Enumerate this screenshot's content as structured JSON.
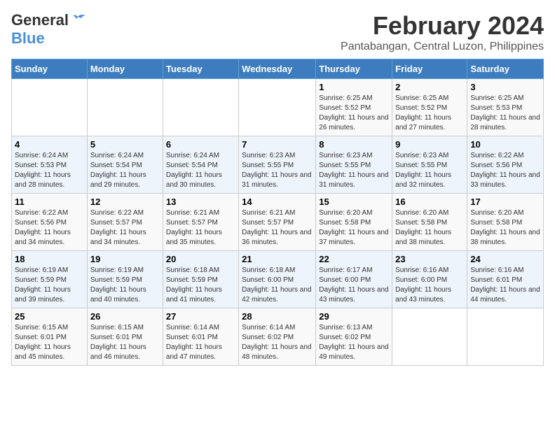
{
  "logo": {
    "general": "General",
    "blue": "Blue"
  },
  "title": "February 2024",
  "subtitle": "Pantabangan, Central Luzon, Philippines",
  "days": [
    "Sunday",
    "Monday",
    "Tuesday",
    "Wednesday",
    "Thursday",
    "Friday",
    "Saturday"
  ],
  "weeks": [
    [
      {
        "day": "",
        "info": ""
      },
      {
        "day": "",
        "info": ""
      },
      {
        "day": "",
        "info": ""
      },
      {
        "day": "",
        "info": ""
      },
      {
        "day": "1",
        "info": "Sunrise: 6:25 AM\nSunset: 5:52 PM\nDaylight: 11 hours and 26 minutes."
      },
      {
        "day": "2",
        "info": "Sunrise: 6:25 AM\nSunset: 5:52 PM\nDaylight: 11 hours and 27 minutes."
      },
      {
        "day": "3",
        "info": "Sunrise: 6:25 AM\nSunset: 5:53 PM\nDaylight: 11 hours and 28 minutes."
      }
    ],
    [
      {
        "day": "4",
        "info": "Sunrise: 6:24 AM\nSunset: 5:53 PM\nDaylight: 11 hours and 28 minutes."
      },
      {
        "day": "5",
        "info": "Sunrise: 6:24 AM\nSunset: 5:54 PM\nDaylight: 11 hours and 29 minutes."
      },
      {
        "day": "6",
        "info": "Sunrise: 6:24 AM\nSunset: 5:54 PM\nDaylight: 11 hours and 30 minutes."
      },
      {
        "day": "7",
        "info": "Sunrise: 6:23 AM\nSunset: 5:55 PM\nDaylight: 11 hours and 31 minutes."
      },
      {
        "day": "8",
        "info": "Sunrise: 6:23 AM\nSunset: 5:55 PM\nDaylight: 11 hours and 31 minutes."
      },
      {
        "day": "9",
        "info": "Sunrise: 6:23 AM\nSunset: 5:55 PM\nDaylight: 11 hours and 32 minutes."
      },
      {
        "day": "10",
        "info": "Sunrise: 6:22 AM\nSunset: 5:56 PM\nDaylight: 11 hours and 33 minutes."
      }
    ],
    [
      {
        "day": "11",
        "info": "Sunrise: 6:22 AM\nSunset: 5:56 PM\nDaylight: 11 hours and 34 minutes."
      },
      {
        "day": "12",
        "info": "Sunrise: 6:22 AM\nSunset: 5:57 PM\nDaylight: 11 hours and 34 minutes."
      },
      {
        "day": "13",
        "info": "Sunrise: 6:21 AM\nSunset: 5:57 PM\nDaylight: 11 hours and 35 minutes."
      },
      {
        "day": "14",
        "info": "Sunrise: 6:21 AM\nSunset: 5:57 PM\nDaylight: 11 hours and 36 minutes."
      },
      {
        "day": "15",
        "info": "Sunrise: 6:20 AM\nSunset: 5:58 PM\nDaylight: 11 hours and 37 minutes."
      },
      {
        "day": "16",
        "info": "Sunrise: 6:20 AM\nSunset: 5:58 PM\nDaylight: 11 hours and 38 minutes."
      },
      {
        "day": "17",
        "info": "Sunrise: 6:20 AM\nSunset: 5:58 PM\nDaylight: 11 hours and 38 minutes."
      }
    ],
    [
      {
        "day": "18",
        "info": "Sunrise: 6:19 AM\nSunset: 5:59 PM\nDaylight: 11 hours and 39 minutes."
      },
      {
        "day": "19",
        "info": "Sunrise: 6:19 AM\nSunset: 5:59 PM\nDaylight: 11 hours and 40 minutes."
      },
      {
        "day": "20",
        "info": "Sunrise: 6:18 AM\nSunset: 5:59 PM\nDaylight: 11 hours and 41 minutes."
      },
      {
        "day": "21",
        "info": "Sunrise: 6:18 AM\nSunset: 6:00 PM\nDaylight: 11 hours and 42 minutes."
      },
      {
        "day": "22",
        "info": "Sunrise: 6:17 AM\nSunset: 6:00 PM\nDaylight: 11 hours and 43 minutes."
      },
      {
        "day": "23",
        "info": "Sunrise: 6:16 AM\nSunset: 6:00 PM\nDaylight: 11 hours and 43 minutes."
      },
      {
        "day": "24",
        "info": "Sunrise: 6:16 AM\nSunset: 6:01 PM\nDaylight: 11 hours and 44 minutes."
      }
    ],
    [
      {
        "day": "25",
        "info": "Sunrise: 6:15 AM\nSunset: 6:01 PM\nDaylight: 11 hours and 45 minutes."
      },
      {
        "day": "26",
        "info": "Sunrise: 6:15 AM\nSunset: 6:01 PM\nDaylight: 11 hours and 46 minutes."
      },
      {
        "day": "27",
        "info": "Sunrise: 6:14 AM\nSunset: 6:01 PM\nDaylight: 11 hours and 47 minutes."
      },
      {
        "day": "28",
        "info": "Sunrise: 6:14 AM\nSunset: 6:02 PM\nDaylight: 11 hours and 48 minutes."
      },
      {
        "day": "29",
        "info": "Sunrise: 6:13 AM\nSunset: 6:02 PM\nDaylight: 11 hours and 49 minutes."
      },
      {
        "day": "",
        "info": ""
      },
      {
        "day": "",
        "info": ""
      }
    ]
  ]
}
